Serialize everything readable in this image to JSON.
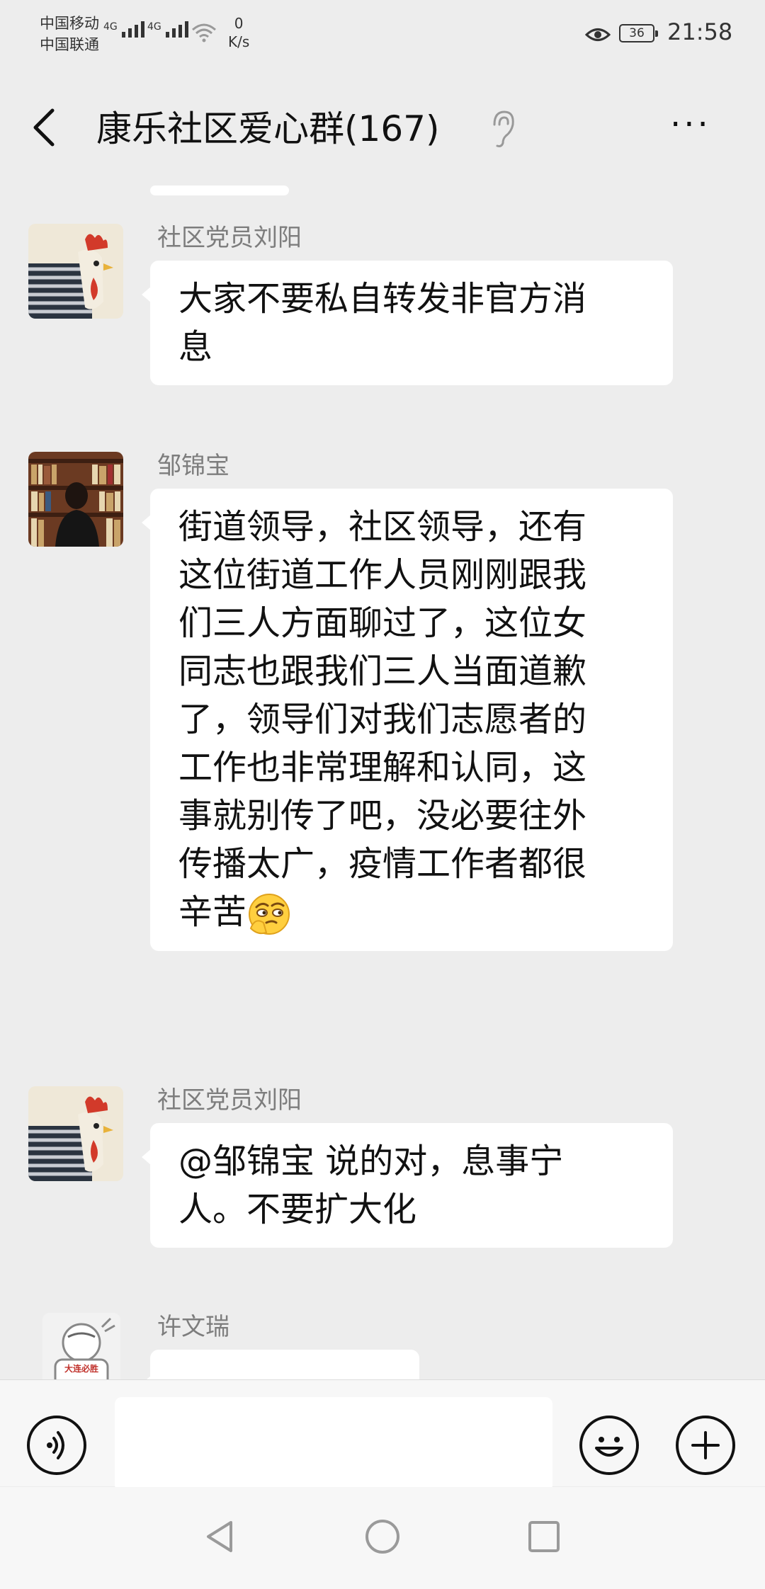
{
  "status_bar": {
    "carrier1": "中国移动",
    "carrier2": "中国联通",
    "signal1_label": "4G",
    "signal2_label": "4G",
    "speed_value": "0",
    "speed_unit": "K/s",
    "battery": "36",
    "time": "21:58"
  },
  "header": {
    "title": "康乐社区爱心群(167)",
    "back_icon": "chevron-left-icon",
    "ear_icon": "ear-icon",
    "more_icon": "ellipsis-icon",
    "more_label": "···"
  },
  "messages": [
    {
      "sender": "社区党员刘阳",
      "avatar": "rooster-avatar",
      "text_lines": [
        "大家不要私自转发非官方消",
        "息"
      ]
    },
    {
      "sender": "邹锦宝",
      "avatar": "bookshelf-avatar",
      "text_lines": [
        "街道领导，社区领导，还有",
        "这位街道工作人员刚刚跟我",
        "们三人方面聊过了，这位女",
        "同志也跟我们三人当面道歉",
        "了，领导们对我们志愿者的",
        "工作也非常理解和认同，这",
        "事就别传了吧，没必要往外",
        "传播太广，疫情工作者都很",
        "辛苦"
      ],
      "emoji": "thinking-face-icon"
    },
    {
      "sender": "社区党员刘阳",
      "avatar": "rooster-avatar",
      "text_lines": [
        "@邹锦宝  说的对，息事宁",
        "人。不要扩大化"
      ]
    },
    {
      "sender": "许文瑞",
      "avatar": "cartoon-avatar",
      "avatar_text": "大连必胜"
    }
  ],
  "input_bar": {
    "voice_icon": "voice-icon",
    "emoji_icon": "smiley-icon",
    "plus_icon": "plus-icon",
    "input_value": ""
  },
  "system_nav": [
    "back-triangle-icon",
    "home-circle-icon",
    "recents-square-icon"
  ],
  "colors": {
    "background": "#ededed",
    "bubble": "#ffffff",
    "sender_text": "#7d7d7d"
  }
}
